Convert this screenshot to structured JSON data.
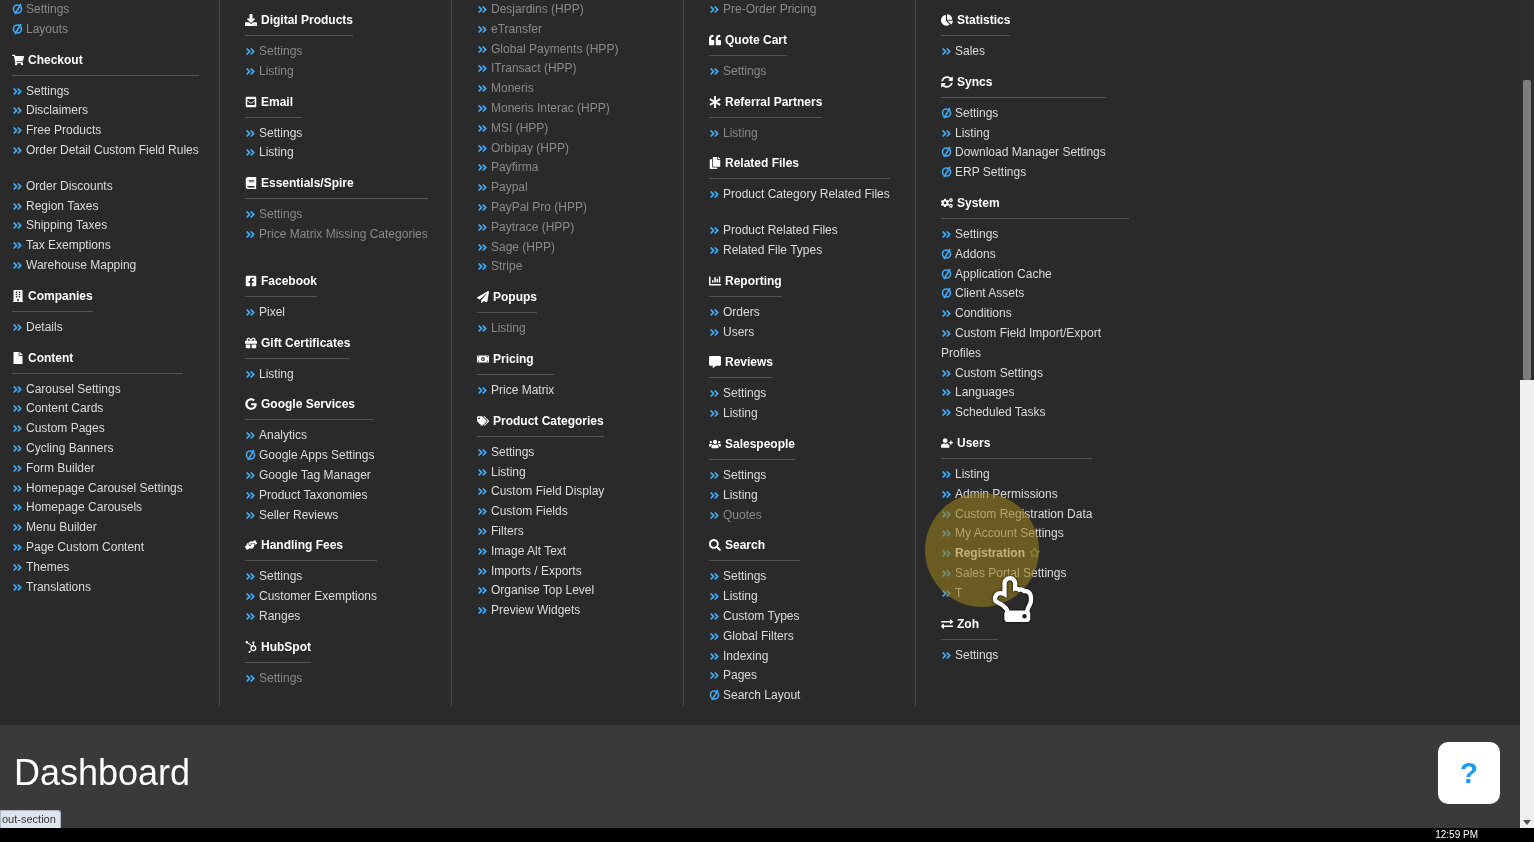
{
  "menu": {
    "columns": [
      {
        "sections": [
          {
            "items": [
              {
                "label": "Settings",
                "kind": "sync-link",
                "disabled": true,
                "selected": false
              },
              {
                "label": "Layouts",
                "kind": "sync-link",
                "disabled": true,
                "selected": false
              }
            ]
          },
          {
            "title": "Checkout",
            "kind": "cart",
            "items": [
              {
                "label": "Settings",
                "kind": "link",
                "disabled": false,
                "selected": false
              },
              {
                "label": "Disclaimers",
                "kind": "link",
                "disabled": false,
                "selected": false
              },
              {
                "label": "Free Products",
                "kind": "link",
                "disabled": false,
                "selected": false
              },
              {
                "label": "Order Detail Custom Field Rules",
                "kind": "link",
                "disabled": false,
                "selected": false
              },
              {
                "kind": "spacer"
              },
              {
                "label": "Order Discounts",
                "kind": "link",
                "disabled": false,
                "selected": false
              },
              {
                "label": "Region Taxes",
                "kind": "link",
                "disabled": false,
                "selected": false
              },
              {
                "label": "Shipping Taxes",
                "kind": "link",
                "disabled": false,
                "selected": false
              },
              {
                "label": "Tax Exemptions",
                "kind": "link",
                "disabled": false,
                "selected": false
              },
              {
                "label": "Warehouse Mapping",
                "kind": "link",
                "disabled": false,
                "selected": false
              }
            ]
          },
          {
            "title": "Companies",
            "kind": "building",
            "items": [
              {
                "label": "Details",
                "kind": "link",
                "disabled": false,
                "selected": false
              }
            ]
          },
          {
            "title": "Content",
            "kind": "file",
            "items": [
              {
                "label": "Carousel Settings",
                "kind": "link",
                "disabled": false,
                "selected": false
              },
              {
                "label": "Content Cards",
                "kind": "link",
                "disabled": false,
                "selected": false
              },
              {
                "label": "Custom Pages",
                "kind": "link",
                "disabled": false,
                "selected": false
              },
              {
                "label": "Cycling Banners",
                "kind": "link",
                "disabled": false,
                "selected": false
              },
              {
                "label": "Form Builder",
                "kind": "link",
                "disabled": false,
                "selected": false
              },
              {
                "label": "Homepage Carousel Settings",
                "kind": "link",
                "disabled": false,
                "selected": false
              },
              {
                "label": "Homepage Carousels",
                "kind": "link",
                "disabled": false,
                "selected": false
              },
              {
                "label": "Menu Builder",
                "kind": "link",
                "disabled": false,
                "selected": false
              },
              {
                "label": "Page Custom Content",
                "kind": "link",
                "disabled": false,
                "selected": false
              },
              {
                "label": "Themes",
                "kind": "link",
                "disabled": false,
                "selected": false
              },
              {
                "label": "Translations",
                "kind": "link",
                "disabled": false,
                "selected": false
              }
            ]
          }
        ]
      },
      {
        "sections": [
          {
            "title": "Digital Products",
            "kind": "download",
            "items": [
              {
                "label": "Settings",
                "kind": "link",
                "disabled": true,
                "selected": false
              },
              {
                "label": "Listing",
                "kind": "link",
                "disabled": true,
                "selected": false
              }
            ]
          },
          {
            "title": "Email",
            "kind": "envelope",
            "items": [
              {
                "label": "Settings",
                "kind": "link",
                "disabled": false,
                "selected": false
              },
              {
                "label": "Listing",
                "kind": "link",
                "disabled": false,
                "selected": false
              }
            ]
          },
          {
            "title": "Essentials/Spire",
            "kind": "book",
            "items": [
              {
                "label": "Settings",
                "kind": "link",
                "disabled": true,
                "selected": false
              },
              {
                "label": "Price Matrix Missing Categories",
                "kind": "link",
                "disabled": true,
                "selected": false
              },
              {
                "kind": "spacer"
              }
            ]
          },
          {
            "title": "Facebook",
            "kind": "facebook",
            "items": [
              {
                "label": "Pixel",
                "kind": "link",
                "disabled": false,
                "selected": false
              }
            ]
          },
          {
            "title": "Gift Certificates",
            "kind": "gift",
            "items": [
              {
                "label": "Listing",
                "kind": "link",
                "disabled": false,
                "selected": false
              }
            ]
          },
          {
            "title": "Google Services",
            "kind": "google",
            "items": [
              {
                "label": "Analytics",
                "kind": "link",
                "disabled": false,
                "selected": false
              },
              {
                "label": "Google Apps Settings",
                "kind": "sync-link",
                "disabled": false,
                "selected": false
              },
              {
                "label": "Google Tag Manager",
                "kind": "link",
                "disabled": false,
                "selected": false
              },
              {
                "label": "Product Taxonomies",
                "kind": "link",
                "disabled": false,
                "selected": false
              },
              {
                "label": "Seller Reviews",
                "kind": "link",
                "disabled": false,
                "selected": false
              }
            ]
          },
          {
            "title": "Handling Fees",
            "kind": "hands",
            "items": [
              {
                "label": "Settings",
                "kind": "link",
                "disabled": false,
                "selected": false
              },
              {
                "label": "Customer Exemptions",
                "kind": "link",
                "disabled": false,
                "selected": false
              },
              {
                "label": "Ranges",
                "kind": "link",
                "disabled": false,
                "selected": false
              }
            ]
          },
          {
            "title": "HubSpot",
            "kind": "hubspot",
            "items": [
              {
                "label": "Settings",
                "kind": "link",
                "disabled": true,
                "selected": false
              }
            ]
          }
        ]
      },
      {
        "sections": [
          {
            "items": [
              {
                "label": "Desjardins (HPP)",
                "kind": "link",
                "disabled": true,
                "selected": false
              },
              {
                "label": "eTransfer",
                "kind": "link",
                "disabled": true,
                "selected": false
              },
              {
                "label": "Global Payments (HPP)",
                "kind": "link",
                "disabled": true,
                "selected": false
              },
              {
                "label": "ITransact (HPP)",
                "kind": "link",
                "disabled": true,
                "selected": false
              },
              {
                "label": "Moneris",
                "kind": "link",
                "disabled": true,
                "selected": false
              },
              {
                "label": "Moneris Interac (HPP)",
                "kind": "link",
                "disabled": true,
                "selected": false
              },
              {
                "label": "MSI (HPP)",
                "kind": "link",
                "disabled": true,
                "selected": false
              },
              {
                "label": "Orbipay (HPP)",
                "kind": "link",
                "disabled": true,
                "selected": false
              },
              {
                "label": "Payfirma",
                "kind": "link",
                "disabled": true,
                "selected": false
              },
              {
                "label": "Paypal",
                "kind": "link",
                "disabled": true,
                "selected": false
              },
              {
                "label": "PayPal Pro (HPP)",
                "kind": "link",
                "disabled": true,
                "selected": false
              },
              {
                "label": "Paytrace (HPP)",
                "kind": "link",
                "disabled": true,
                "selected": false
              },
              {
                "label": "Sage (HPP)",
                "kind": "link",
                "disabled": true,
                "selected": false
              },
              {
                "label": "Stripe",
                "kind": "link",
                "disabled": true,
                "selected": false
              }
            ]
          },
          {
            "title": "Popups",
            "kind": "plane",
            "items": [
              {
                "label": "Listing",
                "kind": "link",
                "disabled": true,
                "selected": false
              }
            ]
          },
          {
            "title": "Pricing",
            "kind": "money",
            "items": [
              {
                "label": "Price Matrix",
                "kind": "link",
                "disabled": false,
                "selected": false
              }
            ]
          },
          {
            "title": "Product Categories",
            "kind": "tags",
            "items": [
              {
                "label": "Settings",
                "kind": "link",
                "disabled": false,
                "selected": false
              },
              {
                "label": "Listing",
                "kind": "link",
                "disabled": false,
                "selected": false
              },
              {
                "label": "Custom Field Display",
                "kind": "link",
                "disabled": false,
                "selected": false
              },
              {
                "label": "Custom Fields",
                "kind": "link",
                "disabled": false,
                "selected": false
              },
              {
                "label": "Filters",
                "kind": "link",
                "disabled": false,
                "selected": false
              },
              {
                "label": "Image Alt Text",
                "kind": "link",
                "disabled": false,
                "selected": false
              },
              {
                "label": "Imports / Exports",
                "kind": "link",
                "disabled": false,
                "selected": false
              },
              {
                "label": "Organise Top Level",
                "kind": "link",
                "disabled": false,
                "selected": false
              },
              {
                "label": "Preview Widgets",
                "kind": "link",
                "disabled": false,
                "selected": false
              }
            ]
          }
        ]
      },
      {
        "sections": [
          {
            "items": [
              {
                "label": "Pre-Order Pricing",
                "kind": "link",
                "disabled": true,
                "selected": false
              }
            ]
          },
          {
            "title": "Quote Cart",
            "kind": "quote",
            "items": [
              {
                "label": "Settings",
                "kind": "link",
                "disabled": true,
                "selected": false
              }
            ]
          },
          {
            "title": "Referral Partners",
            "kind": "asterisk",
            "items": [
              {
                "label": "Listing",
                "kind": "link",
                "disabled": true,
                "selected": false
              }
            ]
          },
          {
            "title": "Related Files",
            "kind": "copy",
            "items": [
              {
                "label": "Product Category Related Files",
                "kind": "link",
                "disabled": false,
                "selected": false
              },
              {
                "kind": "spacer"
              },
              {
                "label": "Product Related Files",
                "kind": "link",
                "disabled": false,
                "selected": false
              },
              {
                "label": "Related File Types",
                "kind": "link",
                "disabled": false,
                "selected": false
              }
            ]
          },
          {
            "title": "Reporting",
            "kind": "chart",
            "items": [
              {
                "label": "Orders",
                "kind": "link",
                "disabled": false,
                "selected": false
              },
              {
                "label": "Users",
                "kind": "link",
                "disabled": false,
                "selected": false
              }
            ]
          },
          {
            "title": "Reviews",
            "kind": "comment",
            "items": [
              {
                "label": "Settings",
                "kind": "link",
                "disabled": false,
                "selected": false
              },
              {
                "label": "Listing",
                "kind": "link",
                "disabled": false,
                "selected": false
              }
            ]
          },
          {
            "title": "Salespeople",
            "kind": "users",
            "items": [
              {
                "label": "Settings",
                "kind": "link",
                "disabled": false,
                "selected": false
              },
              {
                "label": "Listing",
                "kind": "link",
                "disabled": false,
                "selected": false
              },
              {
                "label": "Quotes",
                "kind": "link",
                "disabled": true,
                "selected": false
              }
            ]
          },
          {
            "title": "Search",
            "kind": "search",
            "items": [
              {
                "label": "Settings",
                "kind": "link",
                "disabled": false,
                "selected": false
              },
              {
                "label": "Listing",
                "kind": "link",
                "disabled": false,
                "selected": false
              },
              {
                "label": "Custom Types",
                "kind": "link",
                "disabled": false,
                "selected": false
              },
              {
                "label": "Global Filters",
                "kind": "link",
                "disabled": false,
                "selected": false
              },
              {
                "label": "Indexing",
                "kind": "link",
                "disabled": false,
                "selected": false
              },
              {
                "label": "Pages",
                "kind": "link",
                "disabled": false,
                "selected": false
              },
              {
                "label": "Search Layout",
                "kind": "sync-link",
                "disabled": false,
                "selected": false
              }
            ]
          }
        ]
      },
      {
        "sections": [
          {
            "title": "Statistics",
            "kind": "pie",
            "items": [
              {
                "label": "Sales",
                "kind": "link",
                "disabled": false,
                "selected": false
              }
            ]
          },
          {
            "title": "Syncs",
            "kind": "refresh",
            "items": [
              {
                "label": "Settings",
                "kind": "sync-link",
                "disabled": false,
                "selected": false
              },
              {
                "label": "Listing",
                "kind": "link",
                "disabled": false,
                "selected": false
              },
              {
                "label": "Download Manager Settings",
                "kind": "sync-link",
                "disabled": false,
                "selected": false
              },
              {
                "label": "ERP Settings",
                "kind": "sync-link",
                "disabled": false,
                "selected": false
              }
            ]
          },
          {
            "title": "System",
            "kind": "cogs",
            "items": [
              {
                "label": "Settings",
                "kind": "link",
                "disabled": false,
                "selected": false
              },
              {
                "label": "Addons",
                "kind": "sync-link",
                "disabled": false,
                "selected": false
              },
              {
                "label": "Application Cache",
                "kind": "sync-link",
                "disabled": false,
                "selected": false
              },
              {
                "label": "Client Assets",
                "kind": "sync-link",
                "disabled": false,
                "selected": false
              },
              {
                "label": "Conditions",
                "kind": "link",
                "disabled": false,
                "selected": false
              },
              {
                "label": "Custom Field Import/Export Profiles",
                "kind": "link",
                "disabled": false,
                "selected": false
              },
              {
                "label": "Custom Settings",
                "kind": "link",
                "disabled": false,
                "selected": false
              },
              {
                "label": "Languages",
                "kind": "link",
                "disabled": false,
                "selected": false
              },
              {
                "label": "Scheduled Tasks",
                "kind": "link",
                "disabled": false,
                "selected": false
              }
            ]
          },
          {
            "title": "Users",
            "kind": "user-plus",
            "items": [
              {
                "label": "Listing",
                "kind": "link",
                "disabled": false,
                "selected": false
              },
              {
                "label": "Admin Permissions",
                "kind": "link",
                "disabled": false,
                "selected": false
              },
              {
                "label": "Custom Registration Data",
                "kind": "link",
                "disabled": false,
                "selected": false
              },
              {
                "label": "My Account Settings",
                "kind": "link",
                "disabled": false,
                "selected": false
              },
              {
                "label": "Registration",
                "kind": "link",
                "disabled": false,
                "selected": true
              },
              {
                "label": "Sales Portal Settings",
                "kind": "link",
                "disabled": false,
                "selected": false
              },
              {
                "label": "T",
                "kind": "link",
                "disabled": false,
                "selected": false
              }
            ]
          },
          {
            "title": "Zoh",
            "kind": "swap",
            "items": [
              {
                "label": "Settings",
                "kind": "link",
                "disabled": false,
                "selected": false
              }
            ]
          }
        ]
      }
    ]
  },
  "dashboard": {
    "title": "Dashboard",
    "help_button": "?"
  },
  "status_tooltip": "out-section",
  "taskbar": {
    "clock": "12:59 PM"
  }
}
